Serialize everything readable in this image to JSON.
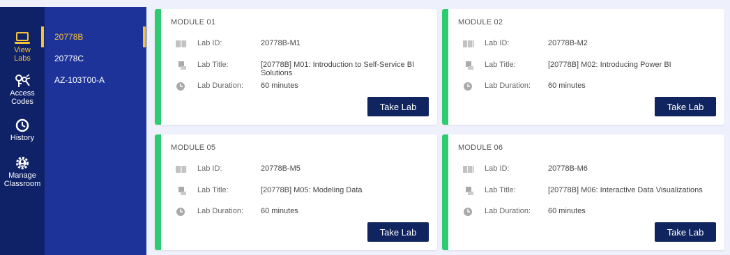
{
  "nav": {
    "items": [
      {
        "label_1": "View",
        "label_2": "Labs",
        "icon": "laptop-icon"
      },
      {
        "label_1": "Access",
        "label_2": "Codes",
        "icon": "keys-icon"
      },
      {
        "label_1": "History",
        "label_2": "",
        "icon": "clock-icon"
      },
      {
        "label_1": "Manage",
        "label_2": "Classroom",
        "icon": "gear-user-icon"
      }
    ]
  },
  "courses": [
    "20778B",
    "20778C",
    "AZ-103T00-A"
  ],
  "labels": {
    "lab_id": "Lab ID:",
    "lab_title": "Lab Title:",
    "lab_duration": "Lab Duration:",
    "take_lab": "Take Lab"
  },
  "cards": [
    {
      "module": "MODULE 01",
      "lab_id": "20778B-M1",
      "title": "[20778B] M01: Introduction to Self-Service BI Solutions",
      "duration": "60 minutes"
    },
    {
      "module": "MODULE 02",
      "lab_id": "20778B-M2",
      "title": "[20778B] M02: Introducing Power BI",
      "duration": "60 minutes"
    },
    {
      "module": "MODULE 05",
      "lab_id": "20778B-M5",
      "title": "[20778B] M05: Modeling Data",
      "duration": "60 minutes"
    },
    {
      "module": "MODULE 06",
      "lab_id": "20778B-M6",
      "title": "[20778B] M06: Interactive Data Visualizations",
      "duration": "60 minutes"
    }
  ],
  "colors": {
    "rail": "#0f2267",
    "course_panel": "#1d3399",
    "active": "#f5c23a",
    "card_accent": "#2ecc71",
    "button": "#10245f"
  }
}
